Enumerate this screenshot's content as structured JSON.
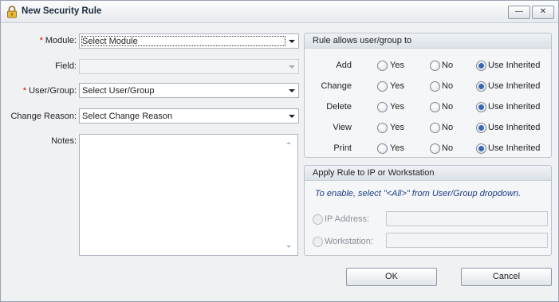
{
  "window": {
    "title": "New Security Rule",
    "minimize_glyph": "—",
    "close_glyph": "✕"
  },
  "form": {
    "required_mark": "*",
    "module": {
      "label": "Module:",
      "value": "Select Module"
    },
    "field": {
      "label": "Field:",
      "value": ""
    },
    "user_group": {
      "label": "User/Group:",
      "value": "Select User/Group"
    },
    "change_reason": {
      "label": "Change Reason:",
      "value": "Select Change Reason"
    },
    "notes": {
      "label": "Notes:",
      "value": ""
    }
  },
  "permissions": {
    "title": "Rule allows user/group to",
    "options": [
      "Yes",
      "No",
      "Use Inherited"
    ],
    "rows": [
      {
        "label": "Add",
        "selected": "Use Inherited"
      },
      {
        "label": "Change",
        "selected": "Use Inherited"
      },
      {
        "label": "Delete",
        "selected": "Use Inherited"
      },
      {
        "label": "View",
        "selected": "Use Inherited"
      },
      {
        "label": "Print",
        "selected": "Use Inherited"
      }
    ]
  },
  "ip_group": {
    "title": "Apply Rule to IP or Workstation",
    "hint": "To enable, select \"<All>\" from User/Group dropdown.",
    "ip_label": "IP Address:",
    "workstation_label": "Workstation:",
    "ip_value": "",
    "workstation_value": ""
  },
  "buttons": {
    "ok": "OK",
    "cancel": "Cancel"
  },
  "colors": {
    "accent": "#3a67b3",
    "required": "#d40000",
    "hint": "#1d3f86"
  }
}
